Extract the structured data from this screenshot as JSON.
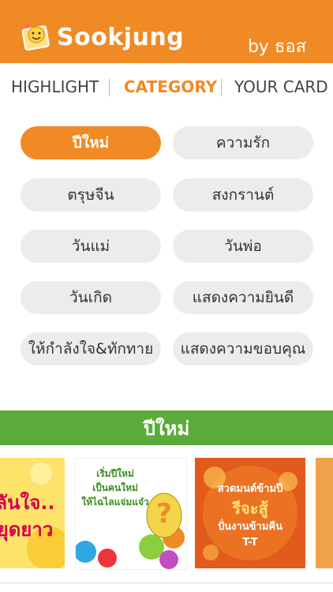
{
  "header": {
    "app_name": "Sookjung",
    "byline": "by ธอส",
    "colors": {
      "accent": "#f08a24"
    }
  },
  "tabs": [
    {
      "label": "HIGHLIGHT",
      "active": false
    },
    {
      "label": "CATEGORY",
      "active": true
    },
    {
      "label": "YOUR CARD",
      "active": false
    }
  ],
  "categories": [
    {
      "label": "ปีใหม่",
      "active": true
    },
    {
      "label": "ความรัก",
      "active": false
    },
    {
      "label": "ตรุษจีน",
      "active": false
    },
    {
      "label": "สงกรานต์",
      "active": false
    },
    {
      "label": "วันแม่",
      "active": false
    },
    {
      "label": "วันพ่อ",
      "active": false
    },
    {
      "label": "วันเกิด",
      "active": false
    },
    {
      "label": "แสดงความยินดี",
      "active": false
    },
    {
      "label": "ให้กำลังใจ&ทักทาย",
      "active": false
    },
    {
      "label": "แสดงความขอบคุณ",
      "active": false
    }
  ],
  "section": {
    "title": "ปีใหม่",
    "color": "#5aab3a"
  },
  "cards": [
    {
      "lines": [
        "ลันใจ..",
        "ยุดยาว"
      ],
      "icon": "sunflower-card"
    },
    {
      "lines": [
        "เริ่มปีใหม่",
        "เป็นคนใหม่",
        "ให้ไฉไลแจ่มแจ๋ว"
      ],
      "badge": "?",
      "icon": "balloon-card"
    },
    {
      "lines": [
        "สวดมนต์ข้ามปี",
        "รีจะสู้",
        "ปั่นงานข้ามคืน",
        "T-T"
      ],
      "icon": "fireworks-card"
    }
  ]
}
